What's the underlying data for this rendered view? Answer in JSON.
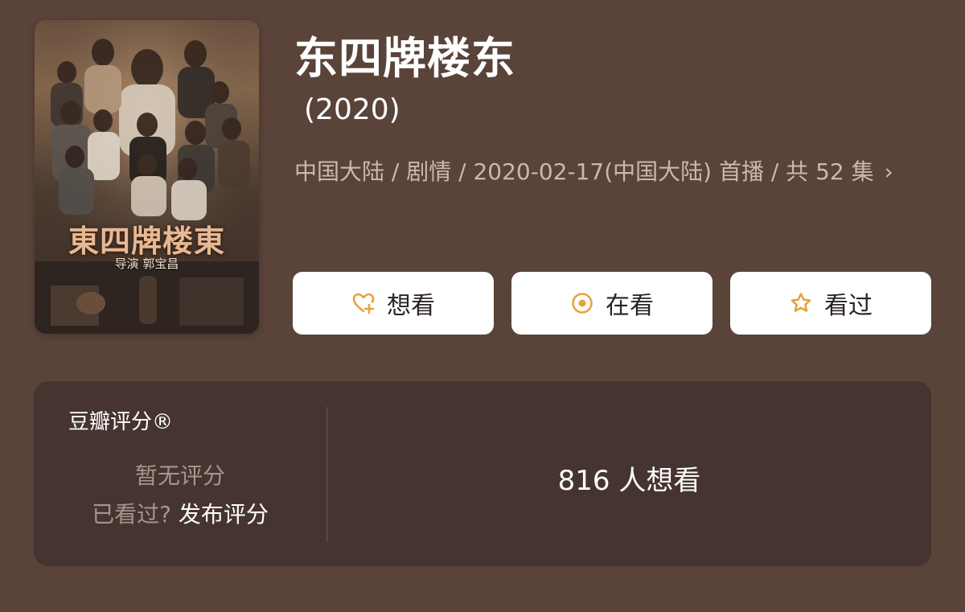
{
  "poster": {
    "title_text": "東四牌楼東",
    "director_text": "导演 郭宝昌"
  },
  "header": {
    "title": "东四牌楼东",
    "year": "(2020)",
    "meta": "中国大陆 / 剧情 / 2020-02-17(中国大陆) 首播 / 共 52 集",
    "chevron": "›"
  },
  "actions": {
    "want_label": "想看",
    "watching_label": "在看",
    "watched_label": "看过"
  },
  "rating": {
    "title": "豆瓣评分®",
    "no_rating": "暂无评分",
    "seen_question": "已看过? ",
    "publish_label": "发布评分",
    "want_count": "816 人想看"
  },
  "colors": {
    "background": "#5a4339",
    "panel": "#463430",
    "accent": "#e8a33d",
    "button_bg": "#ffffff"
  },
  "icons": {
    "want": "heart-plus-icon",
    "watching": "target-dot-icon",
    "watched": "star-icon",
    "meta_more": "chevron-right-icon"
  }
}
